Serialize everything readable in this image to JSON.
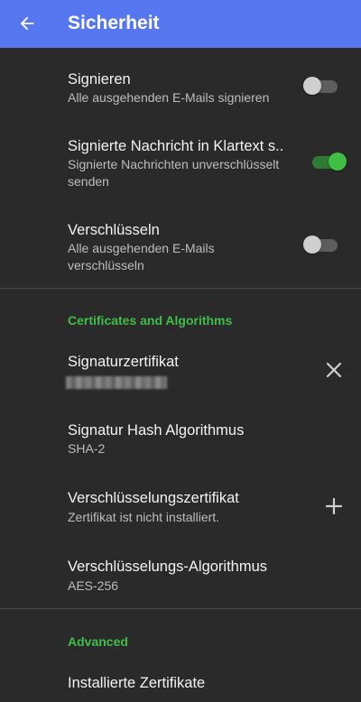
{
  "app_bar": {
    "title": "Sicherheit",
    "back_icon": "arrow-left-icon"
  },
  "settings": {
    "signieren": {
      "title": "Signieren",
      "subtitle": "Alle ausgehenden E-Mails signieren",
      "enabled": false
    },
    "klartext": {
      "title": "Signierte Nachricht in Klartext s..",
      "subtitle": "Signierte Nachrichten unverschlüsselt senden",
      "enabled": true
    },
    "verschluesseln": {
      "title": "Verschlüsseln",
      "subtitle": "Alle ausgehenden E-Mails verschlüsseln",
      "enabled": false
    }
  },
  "certificates_section": {
    "header": "Certificates and Algorithms",
    "signaturzertifikat": {
      "title": "Signaturzertifikat",
      "action_icon": "close-icon"
    },
    "hash_algorithmus": {
      "title": "Signatur Hash Algorithmus",
      "value": "SHA-2"
    },
    "verschluesselungszertifikat": {
      "title": "Verschlüsselungszertifikat",
      "subtitle": "Zertifikat ist nicht installiert.",
      "action_icon": "plus-icon"
    },
    "verschluesselungs_algorithmus": {
      "title": "Verschlüsselungs-Algorithmus",
      "value": "AES-256"
    }
  },
  "advanced_section": {
    "header": "Advanced",
    "installierte": {
      "title": "Installierte Zertifikate"
    }
  },
  "colors": {
    "app_bar": "#5677f0",
    "background": "#2a2a2a",
    "accent_green": "#3fbf49"
  }
}
